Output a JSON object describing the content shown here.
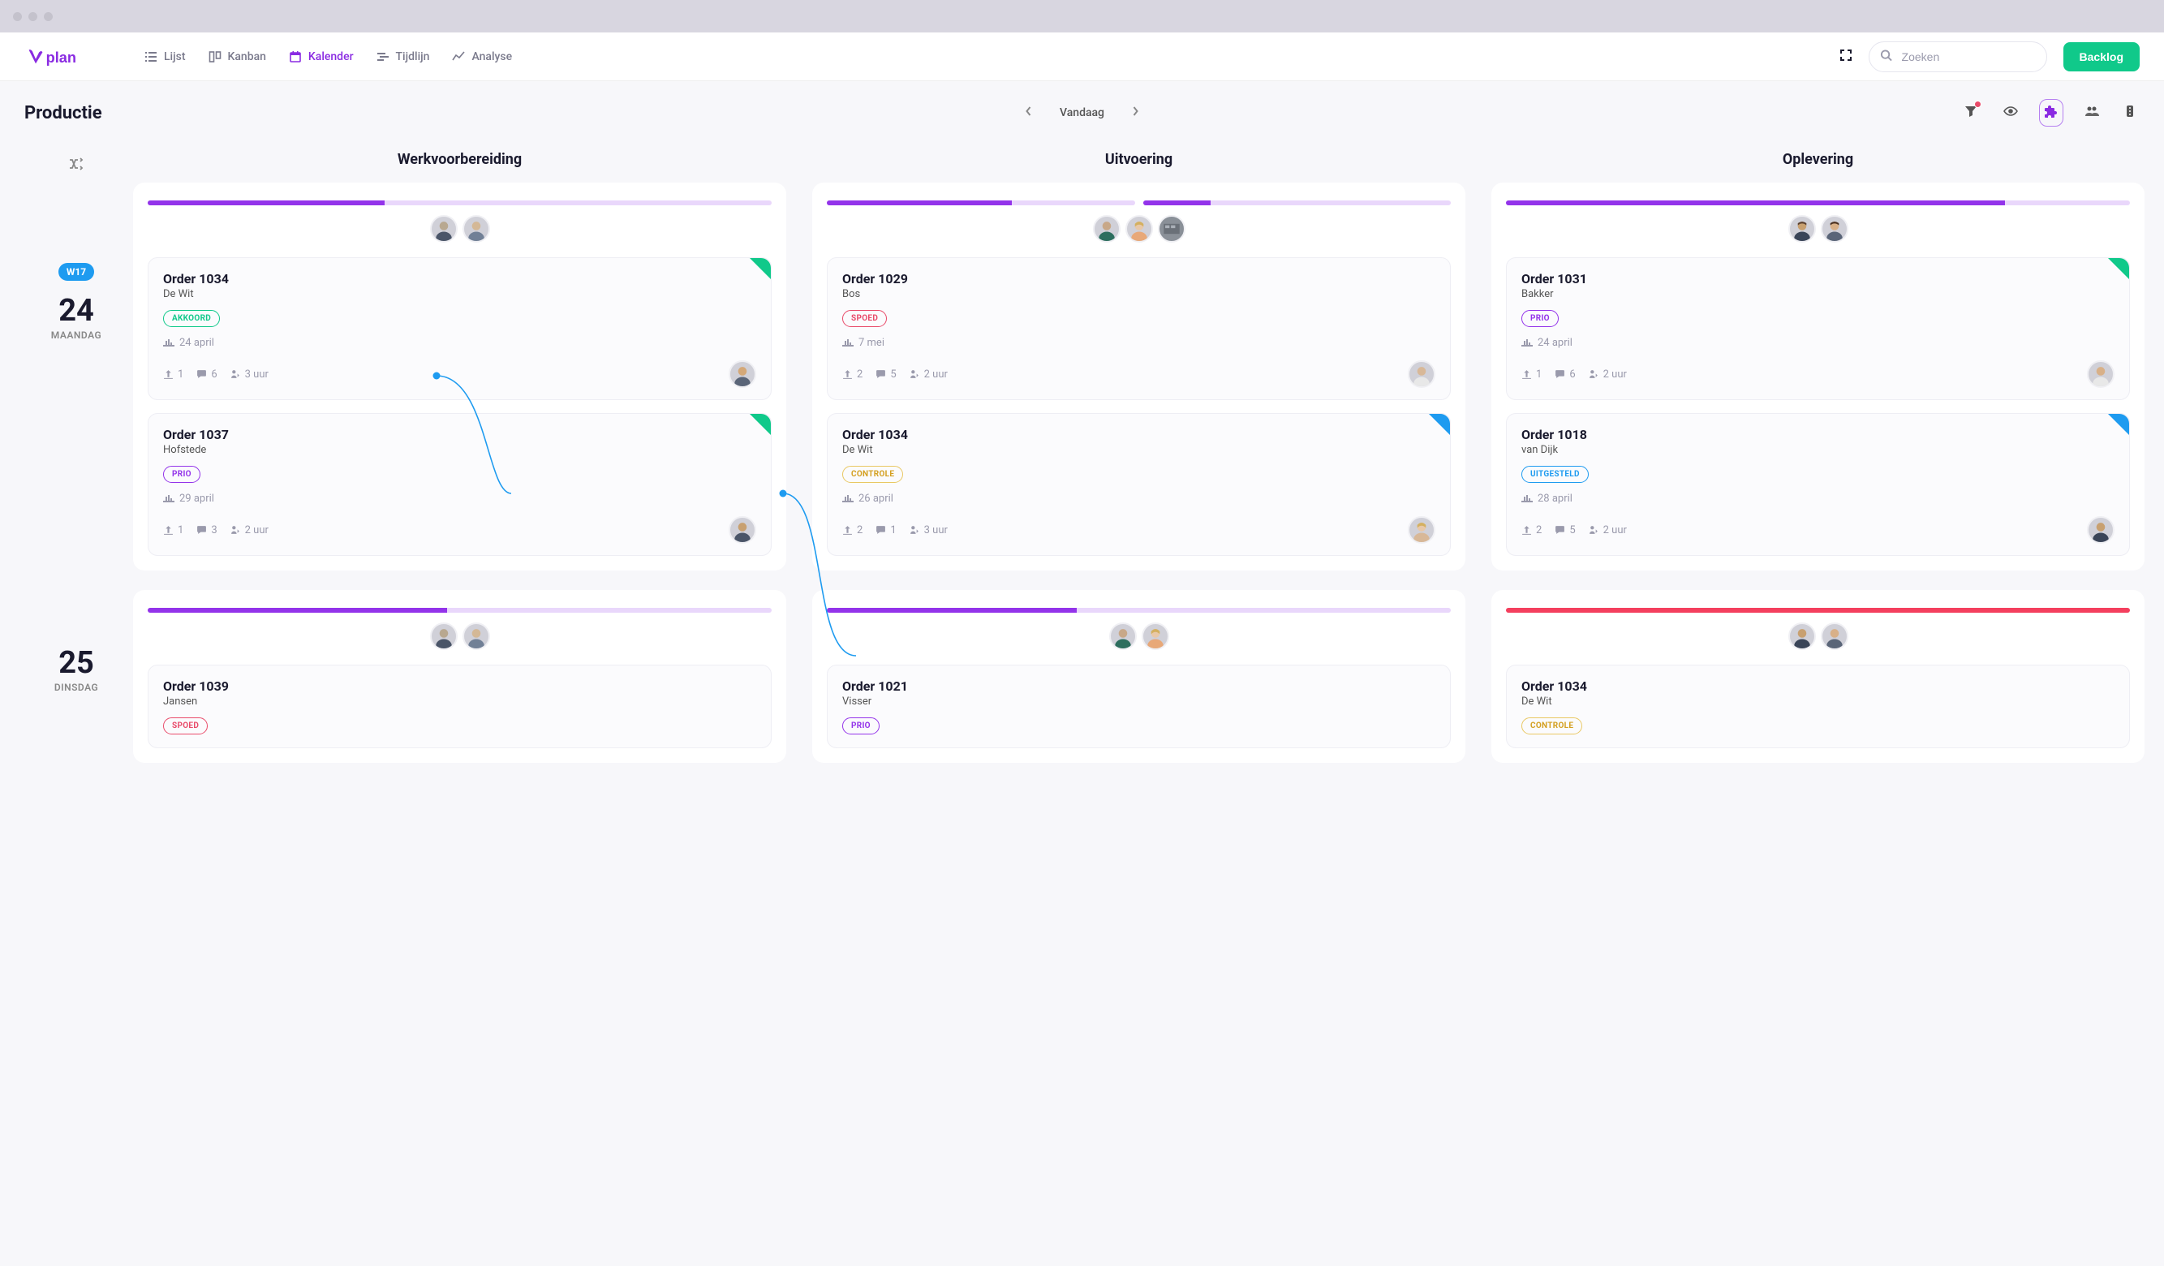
{
  "nav": {
    "lijst": "Lijst",
    "kanban": "Kanban",
    "kalender": "Kalender",
    "tijdlijn": "Tijdlijn",
    "analyse": "Analyse"
  },
  "search_placeholder": "Zoeken",
  "backlog_label": "Backlog",
  "page_title": "Productie",
  "today_label": "Vandaag",
  "columns": {
    "c1": "Werkvoorbereiding",
    "c2": "Uitvoering",
    "c3": "Oplevering"
  },
  "week_badge": "W17",
  "days": [
    {
      "num": "24",
      "name": "MAANDAG"
    },
    {
      "num": "25",
      "name": "DINSDAG"
    }
  ],
  "tags": {
    "akkoord": "AKKOORD",
    "spoed": "SPOED",
    "prio": "PRIO",
    "controle": "CONTROLE",
    "uitgesteld": "UITGESTELD"
  },
  "cards": {
    "r1c1a": {
      "title": "Order 1034",
      "sub": "De Wit",
      "date": "24 april",
      "s1": "1",
      "s2": "6",
      "s3": "3 uur"
    },
    "r1c1b": {
      "title": "Order 1037",
      "sub": "Hofstede",
      "date": "29 april",
      "s1": "1",
      "s2": "3",
      "s3": "2 uur"
    },
    "r1c2a": {
      "title": "Order 1029",
      "sub": "Bos",
      "date": "7 mei",
      "s1": "2",
      "s2": "5",
      "s3": "2 uur"
    },
    "r1c2b": {
      "title": "Order 1034",
      "sub": "De Wit",
      "date": "26 april",
      "s1": "2",
      "s2": "1",
      "s3": "3 uur"
    },
    "r1c3a": {
      "title": "Order 1031",
      "sub": "Bakker",
      "date": "24 april",
      "s1": "1",
      "s2": "6",
      "s3": "2 uur"
    },
    "r1c3b": {
      "title": "Order 1018",
      "sub": "van Dijk",
      "date": "28 april",
      "s1": "2",
      "s2": "5",
      "s3": "2 uur"
    },
    "r2c1a": {
      "title": "Order 1039",
      "sub": "Jansen"
    },
    "r2c2a": {
      "title": "Order 1021",
      "sub": "Visser"
    },
    "r2c3a": {
      "title": "Order 1034",
      "sub": "De Wit"
    }
  },
  "progress": {
    "d1c1": [
      38
    ],
    "d1c2": [
      60,
      22
    ],
    "d1c3": [
      80
    ],
    "d2c1": [
      48
    ],
    "d2c2": [
      40
    ],
    "d2c3_pink": [
      100
    ]
  },
  "colors": {
    "brand": "#8a2be2",
    "green": "#10c98a",
    "blue": "#1e9bf0",
    "red": "#e94b6a",
    "pink": "#f43f5e"
  }
}
